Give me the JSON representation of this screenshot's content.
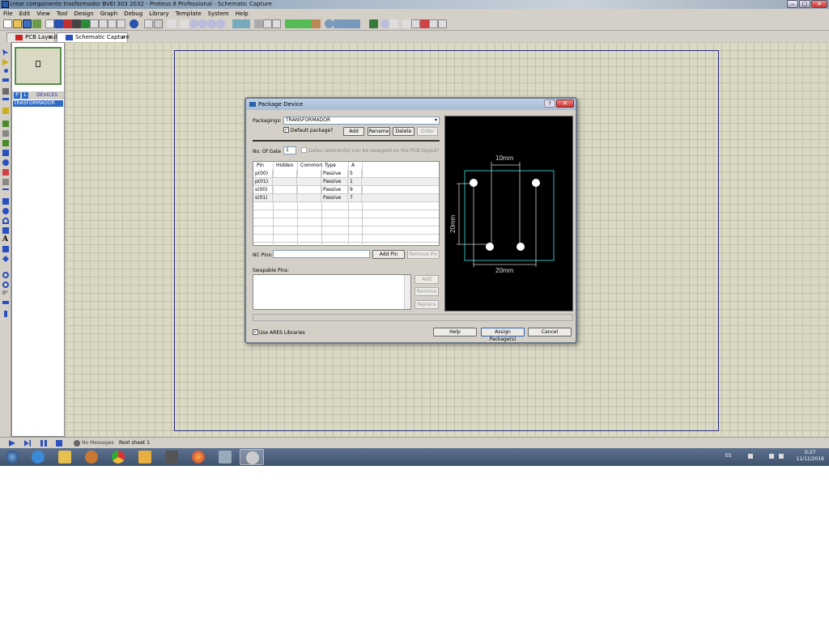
{
  "window": {
    "title": "crear componente trasformador BVEI 303 2032 - Proteus 8 Professional - Schematic Capture"
  },
  "menu": [
    "File",
    "Edit",
    "View",
    "Tool",
    "Design",
    "Graph",
    "Debug",
    "Library",
    "Template",
    "System",
    "Help"
  ],
  "tabs": [
    {
      "label": "PCB Layout",
      "close": "×",
      "color": "#cc2222"
    },
    {
      "label": "Schematic Capture",
      "close": "×",
      "color": "#2a4fc0"
    }
  ],
  "side_panel": {
    "p_button": "P",
    "l_button": "L",
    "devices_label": "DEVICES",
    "selected_device": "TRASFORMADOR"
  },
  "statusbar": {
    "messages": "No Messages",
    "sheet": "Root sheet 1"
  },
  "clock": {
    "lang": "ES",
    "time": "0:27",
    "date": "11/12/2016"
  },
  "dialog": {
    "title": "Package Device",
    "help_btn": "?",
    "close_btn": "✕",
    "packagings_label": "Packagings:",
    "packaging_value": "TRANSFORMADOR",
    "default_pkg_label": "Default package?",
    "default_pkg_checked": true,
    "btn_add": "Add",
    "btn_rename": "Rename",
    "btn_delete": "Delete",
    "btn_order": "Order",
    "gates_label": "No. Of Gate",
    "gates_value": "1",
    "gates_swap_label": "Gates (elements) can be swapped on the PCB layout?",
    "table_headers": [
      "Pin",
      "Hidden",
      "Common",
      "Type",
      "A"
    ],
    "pins": [
      {
        "pin": "p(00)",
        "hidden": "",
        "common": "",
        "type": "Passive",
        "a": "5"
      },
      {
        "pin": "p(01)",
        "hidden": "",
        "common": "",
        "type": "Passive",
        "a": "1"
      },
      {
        "pin": "s(00)",
        "hidden": "",
        "common": "",
        "type": "Passive",
        "a": "9"
      },
      {
        "pin": "s(01)",
        "hidden": "",
        "common": "",
        "type": "Passive",
        "a": "7"
      }
    ],
    "empty_rows": 5,
    "nc_pins_label": "NC Pins:",
    "btn_add_pin": "Add Pin",
    "btn_remove_pin": "Remove Pin",
    "swappable_label": "Swapable Pins:",
    "btn_swap_add": "Add",
    "btn_swap_remove": "Remove",
    "btn_swap_replace": "Replace",
    "use_ares_label": "Use ARES Libraries",
    "use_ares_checked": true,
    "btn_help": "Help",
    "btn_assign": "Assign Package(s)",
    "btn_cancel": "Cancel",
    "preview": {
      "dim_top": "10mm",
      "dim_left": "20mm",
      "dim_bottom": "20mm",
      "outline_color": "#3ab4b4",
      "pad_color": "#ffffff"
    }
  }
}
